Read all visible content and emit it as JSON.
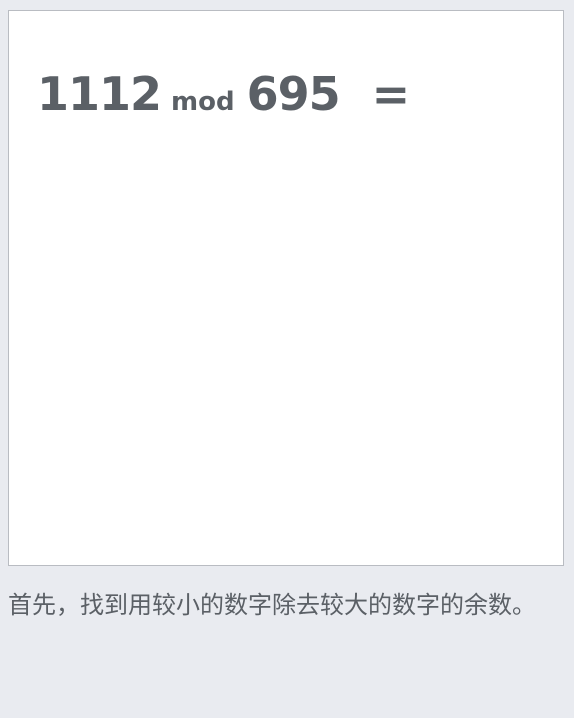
{
  "problem": {
    "dividend": "1112",
    "operator": "mod",
    "divisor": "695",
    "equals": "="
  },
  "hint": {
    "text": "首先，找到用较小的数字除去较大的数字的余数。"
  }
}
